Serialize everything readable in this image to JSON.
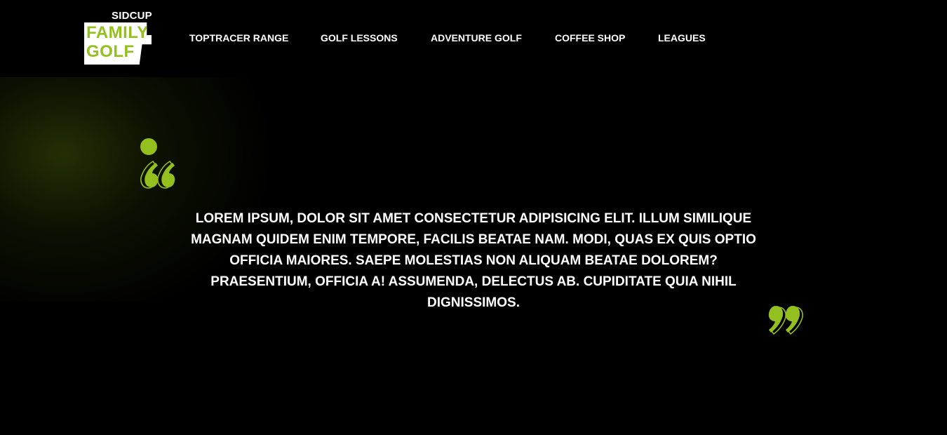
{
  "brand": {
    "top_text": "SIDCUP",
    "line1": "FAMILY",
    "line2": "GOLF",
    "accent_color": "#93c01f"
  },
  "nav": {
    "items": [
      {
        "label": "TOPTRACER RANGE"
      },
      {
        "label": "GOLF LESSONS"
      },
      {
        "label": "ADVENTURE GOLF"
      },
      {
        "label": "COFFEE SHOP"
      },
      {
        "label": "LEAGUES"
      }
    ]
  },
  "testimonial": {
    "quote": "LOREM IPSUM, DOLOR SIT AMET CONSECTETUR ADIPISICING ELIT. ILLUM SIMILIQUE MAGNAM QUIDEM ENIM TEMPORE, FACILIS BEATAE NAM. MODI, QUAS EX QUIS OPTIO OFFICIA MAIORES. SAEPE MOLESTIAS NON ALIQUAM BEATAE DOLOREM? PRAESENTIUM, OFFICIA A! ASSUMENDA, DELECTUS AB. CUPIDITATE QUIA NIHIL DIGNISSIMOS.",
    "open_icon": "quote-open-icon",
    "close_icon": "quote-close-icon"
  },
  "colors": {
    "background": "#000000",
    "text": "#ffffff",
    "accent": "#93c01f"
  }
}
